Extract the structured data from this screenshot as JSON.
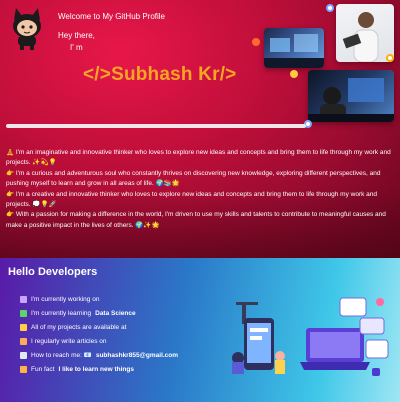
{
  "header": {
    "welcome": "Welcome to My GitHub Profile",
    "hey": "Hey there,",
    "im": "I' m",
    "name_title": "</>Subhash Kr/>",
    "progress_fraction": 0.75
  },
  "bio": [
    "🧘 I'm an imaginative and innovative thinker who loves to explore new ideas and concepts and bring them to life through my work and projects. ✨💫💡",
    "👉 I'm a curious and adventurous soul who constantly thrives on discovering new knowledge, exploring different perspectives, and pushing myself to learn and grow in all areas of life. 🌍📚🌟",
    "👉 I'm a creative and innovative thinker who loves to explore new ideas and concepts and bring them to life through my work and projects. 💭💡🚀",
    "👉 With a passion for making a difference in the world, I'm driven to use my skills and talents to contribute to meaningful causes and make a positive impact in the lives of others. 🌍✨🌟"
  ],
  "developers": {
    "title": "Hello Developers",
    "items": [
      {
        "icon": "telescope-icon",
        "text": "I'm currently working on",
        "link": "",
        "strong": ""
      },
      {
        "icon": "seedling-icon",
        "text": "I'm currently learning",
        "link": "",
        "strong": "Data Science"
      },
      {
        "icon": "handshake-icon",
        "text": "All of my projects are available at",
        "link": "",
        "strong": ""
      },
      {
        "icon": "notebook-icon",
        "text": "I regularly write articles on",
        "link": "",
        "strong": ""
      },
      {
        "icon": "mail-icon",
        "text": "How to reach me: 📧",
        "link": "",
        "strong": "subhashkr855@gmail.com"
      },
      {
        "icon": "lightning-icon",
        "text": "Fun fact",
        "link": "",
        "strong": "I like to learn new things"
      }
    ]
  },
  "colors": {
    "banner": "#c20f3b",
    "title": "#f6a623",
    "link": "#3ea0ff"
  }
}
